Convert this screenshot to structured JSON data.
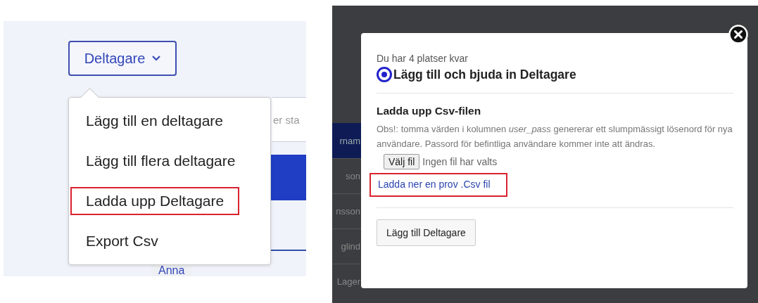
{
  "left": {
    "menu_button": {
      "label": "Deltagare",
      "expanded": true
    },
    "menu_items": [
      {
        "label": "Lägg till en deltagare",
        "highlighted": false
      },
      {
        "label": "Lägg till flera deltagare",
        "highlighted": false
      },
      {
        "label": "Ladda upp Deltagare",
        "highlighted": true
      },
      {
        "label": "Export Csv",
        "highlighted": false
      }
    ],
    "background": {
      "field_text": "er sta",
      "row_text": "Anna"
    }
  },
  "right": {
    "background_cells": [
      "rnam",
      "son",
      "nsson",
      "glind",
      "Lager"
    ],
    "modal": {
      "seats_text": "Du har 4 platser kvar",
      "option": {
        "label": "Lägg till och bjuda in Deltagare",
        "selected": true
      },
      "section_title": "Ladda upp Csv-filen",
      "note": "Obs!: tomma värden i kolumnen *user_pass* genererar ett slumpmässigt lösenord för nya användare. Passord för befintliga användare kommer inte att ändras.",
      "file_button": "Välj fil",
      "file_status": "Ingen fil har valts",
      "sample_link": {
        "label": "Ladda ner en prov .Csv fil",
        "highlighted": true
      },
      "submit_button": "Lägg till Deltagare"
    }
  }
}
